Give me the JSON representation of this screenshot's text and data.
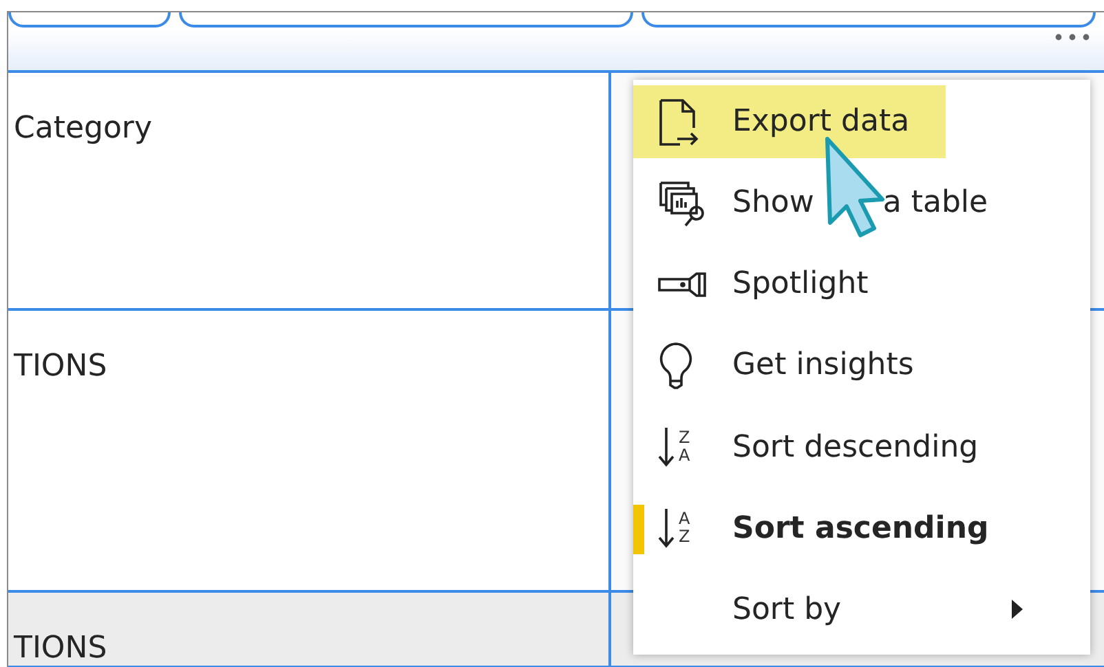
{
  "table": {
    "rows": [
      {
        "cells": [
          "Category"
        ],
        "shaded": false
      },
      {
        "cells": [
          "TIONS"
        ],
        "shaded": false
      },
      {
        "cells": [
          "TIONS"
        ],
        "shaded": true
      }
    ]
  },
  "context_menu": {
    "items": [
      {
        "kind": "command",
        "label": "Export data",
        "highlighted": true,
        "selected": false
      },
      {
        "kind": "command",
        "label": "Show",
        "label_after_cursor": "a table",
        "highlighted": false,
        "selected": false
      },
      {
        "kind": "command",
        "label": "Spotlight",
        "highlighted": false,
        "selected": false
      },
      {
        "kind": "command",
        "label": "Get insights",
        "highlighted": false,
        "selected": false
      },
      {
        "kind": "sort",
        "label": "Sort descending",
        "letters": [
          "Z",
          "A"
        ],
        "highlighted": false,
        "selected": false
      },
      {
        "kind": "sort",
        "label": "Sort ascending",
        "letters": [
          "A",
          "Z"
        ],
        "highlighted": false,
        "selected": true
      },
      {
        "kind": "submenu",
        "label": "Sort by",
        "highlighted": false,
        "selected": false
      }
    ]
  }
}
